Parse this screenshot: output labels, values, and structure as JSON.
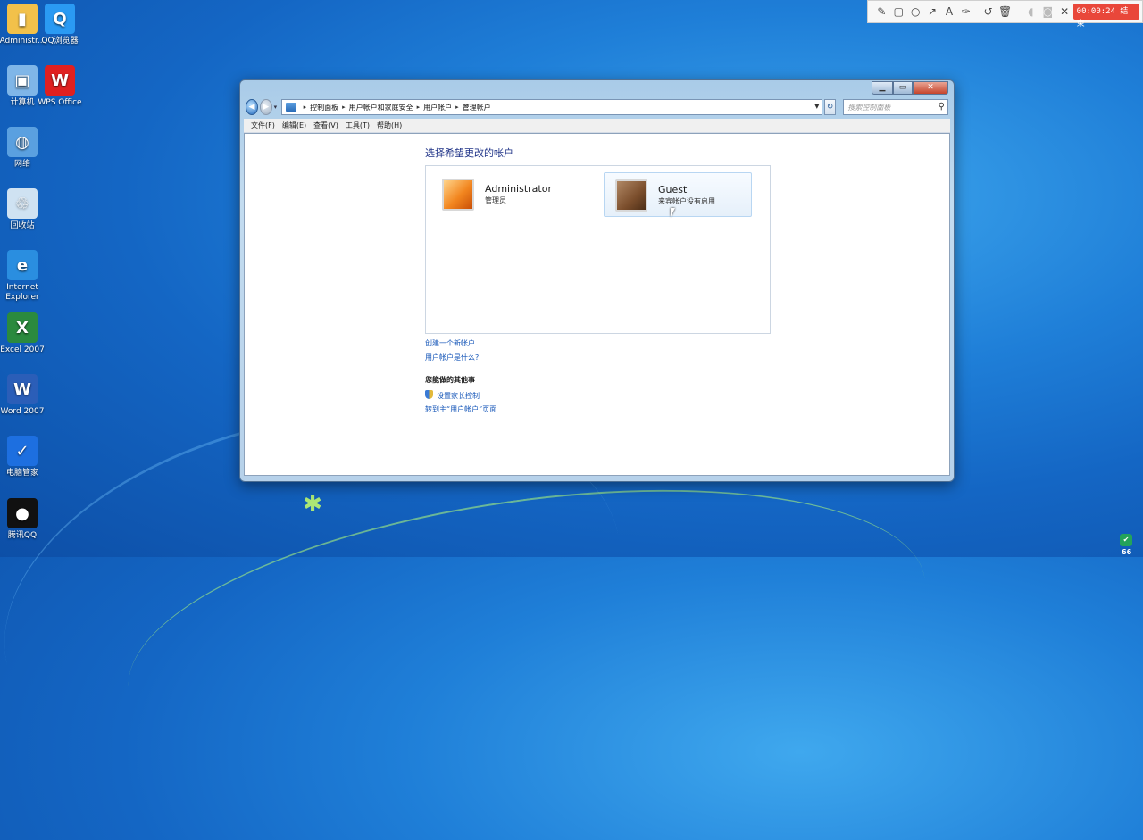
{
  "desktop": {
    "icons": [
      {
        "label": "Administr...",
        "icon": "user-folder-icon",
        "color": "#f2c14a"
      },
      {
        "label": "QQ浏览器",
        "icon": "qq-browser-icon",
        "color": "#2a9af3"
      },
      {
        "label": "计算机",
        "icon": "computer-icon",
        "color": "#7fb6e8"
      },
      {
        "label": "WPS Office",
        "icon": "wps-office-icon",
        "color": "#e02020"
      },
      {
        "label": "网络",
        "icon": "network-icon",
        "color": "#5aa0e0"
      },
      {
        "label": "回收站",
        "icon": "recycle-bin-icon",
        "color": "#cfe2f2"
      },
      {
        "label": "Internet Explorer",
        "icon": "internet-explorer-icon",
        "color": "#2a8ee0"
      },
      {
        "label": "Excel 2007",
        "icon": "excel-icon",
        "color": "#2b8a3e"
      },
      {
        "label": "Word 2007",
        "icon": "word-icon",
        "color": "#2b5eb8"
      },
      {
        "label": "电脑管家",
        "icon": "pc-manager-icon",
        "color": "#1d6fe0"
      },
      {
        "label": "腾讯QQ",
        "icon": "qq-icon",
        "color": "#111111"
      }
    ]
  },
  "recorder": {
    "timer": "00:00:24 结束",
    "tools": [
      "pencil-icon",
      "rectangle-icon",
      "circle-icon",
      "arrow-icon",
      "text-icon",
      "highlighter-icon",
      "undo-icon",
      "trash-icon",
      "mic-icon",
      "camera-icon",
      "close-icon"
    ]
  },
  "window": {
    "breadcrumb": [
      "控制面板",
      "用户帐户和家庭安全",
      "用户帐户",
      "管理帐户"
    ],
    "search_placeholder": "搜索控制面板",
    "menu": [
      "文件(F)",
      "编辑(E)",
      "查看(V)",
      "工具(T)",
      "帮助(H)"
    ],
    "heading": "选择希望更改的帐户",
    "accounts": [
      {
        "name": "Administrator",
        "subtitle": "管理员"
      },
      {
        "name": "Guest",
        "subtitle": "来宾帐户没有启用"
      }
    ],
    "links": {
      "create": "创建一个新帐户",
      "what_is": "用户帐户是什么?"
    },
    "other_tasks_title": "您能做的其他事",
    "parental_controls": "设置家长控制",
    "goto_main": "转到主“用户帐户”页面"
  },
  "tray": {
    "number": "66"
  }
}
